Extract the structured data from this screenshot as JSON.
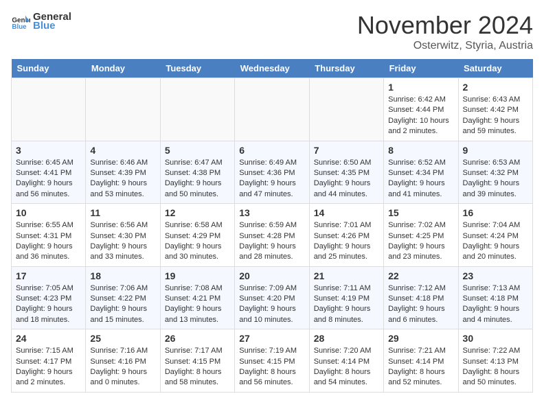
{
  "logo": {
    "text_general": "General",
    "text_blue": "Blue"
  },
  "header": {
    "month": "November 2024",
    "location": "Osterwitz, Styria, Austria"
  },
  "weekdays": [
    "Sunday",
    "Monday",
    "Tuesday",
    "Wednesday",
    "Thursday",
    "Friday",
    "Saturday"
  ],
  "weeks": [
    [
      {
        "day": "",
        "info": ""
      },
      {
        "day": "",
        "info": ""
      },
      {
        "day": "",
        "info": ""
      },
      {
        "day": "",
        "info": ""
      },
      {
        "day": "",
        "info": ""
      },
      {
        "day": "1",
        "info": "Sunrise: 6:42 AM\nSunset: 4:44 PM\nDaylight: 10 hours\nand 2 minutes."
      },
      {
        "day": "2",
        "info": "Sunrise: 6:43 AM\nSunset: 4:42 PM\nDaylight: 9 hours\nand 59 minutes."
      }
    ],
    [
      {
        "day": "3",
        "info": "Sunrise: 6:45 AM\nSunset: 4:41 PM\nDaylight: 9 hours\nand 56 minutes."
      },
      {
        "day": "4",
        "info": "Sunrise: 6:46 AM\nSunset: 4:39 PM\nDaylight: 9 hours\nand 53 minutes."
      },
      {
        "day": "5",
        "info": "Sunrise: 6:47 AM\nSunset: 4:38 PM\nDaylight: 9 hours\nand 50 minutes."
      },
      {
        "day": "6",
        "info": "Sunrise: 6:49 AM\nSunset: 4:36 PM\nDaylight: 9 hours\nand 47 minutes."
      },
      {
        "day": "7",
        "info": "Sunrise: 6:50 AM\nSunset: 4:35 PM\nDaylight: 9 hours\nand 44 minutes."
      },
      {
        "day": "8",
        "info": "Sunrise: 6:52 AM\nSunset: 4:34 PM\nDaylight: 9 hours\nand 41 minutes."
      },
      {
        "day": "9",
        "info": "Sunrise: 6:53 AM\nSunset: 4:32 PM\nDaylight: 9 hours\nand 39 minutes."
      }
    ],
    [
      {
        "day": "10",
        "info": "Sunrise: 6:55 AM\nSunset: 4:31 PM\nDaylight: 9 hours\nand 36 minutes."
      },
      {
        "day": "11",
        "info": "Sunrise: 6:56 AM\nSunset: 4:30 PM\nDaylight: 9 hours\nand 33 minutes."
      },
      {
        "day": "12",
        "info": "Sunrise: 6:58 AM\nSunset: 4:29 PM\nDaylight: 9 hours\nand 30 minutes."
      },
      {
        "day": "13",
        "info": "Sunrise: 6:59 AM\nSunset: 4:28 PM\nDaylight: 9 hours\nand 28 minutes."
      },
      {
        "day": "14",
        "info": "Sunrise: 7:01 AM\nSunset: 4:26 PM\nDaylight: 9 hours\nand 25 minutes."
      },
      {
        "day": "15",
        "info": "Sunrise: 7:02 AM\nSunset: 4:25 PM\nDaylight: 9 hours\nand 23 minutes."
      },
      {
        "day": "16",
        "info": "Sunrise: 7:04 AM\nSunset: 4:24 PM\nDaylight: 9 hours\nand 20 minutes."
      }
    ],
    [
      {
        "day": "17",
        "info": "Sunrise: 7:05 AM\nSunset: 4:23 PM\nDaylight: 9 hours\nand 18 minutes."
      },
      {
        "day": "18",
        "info": "Sunrise: 7:06 AM\nSunset: 4:22 PM\nDaylight: 9 hours\nand 15 minutes."
      },
      {
        "day": "19",
        "info": "Sunrise: 7:08 AM\nSunset: 4:21 PM\nDaylight: 9 hours\nand 13 minutes."
      },
      {
        "day": "20",
        "info": "Sunrise: 7:09 AM\nSunset: 4:20 PM\nDaylight: 9 hours\nand 10 minutes."
      },
      {
        "day": "21",
        "info": "Sunrise: 7:11 AM\nSunset: 4:19 PM\nDaylight: 9 hours\nand 8 minutes."
      },
      {
        "day": "22",
        "info": "Sunrise: 7:12 AM\nSunset: 4:18 PM\nDaylight: 9 hours\nand 6 minutes."
      },
      {
        "day": "23",
        "info": "Sunrise: 7:13 AM\nSunset: 4:18 PM\nDaylight: 9 hours\nand 4 minutes."
      }
    ],
    [
      {
        "day": "24",
        "info": "Sunrise: 7:15 AM\nSunset: 4:17 PM\nDaylight: 9 hours\nand 2 minutes."
      },
      {
        "day": "25",
        "info": "Sunrise: 7:16 AM\nSunset: 4:16 PM\nDaylight: 9 hours\nand 0 minutes."
      },
      {
        "day": "26",
        "info": "Sunrise: 7:17 AM\nSunset: 4:15 PM\nDaylight: 8 hours\nand 58 minutes."
      },
      {
        "day": "27",
        "info": "Sunrise: 7:19 AM\nSunset: 4:15 PM\nDaylight: 8 hours\nand 56 minutes."
      },
      {
        "day": "28",
        "info": "Sunrise: 7:20 AM\nSunset: 4:14 PM\nDaylight: 8 hours\nand 54 minutes."
      },
      {
        "day": "29",
        "info": "Sunrise: 7:21 AM\nSunset: 4:14 PM\nDaylight: 8 hours\nand 52 minutes."
      },
      {
        "day": "30",
        "info": "Sunrise: 7:22 AM\nSunset: 4:13 PM\nDaylight: 8 hours\nand 50 minutes."
      }
    ]
  ]
}
